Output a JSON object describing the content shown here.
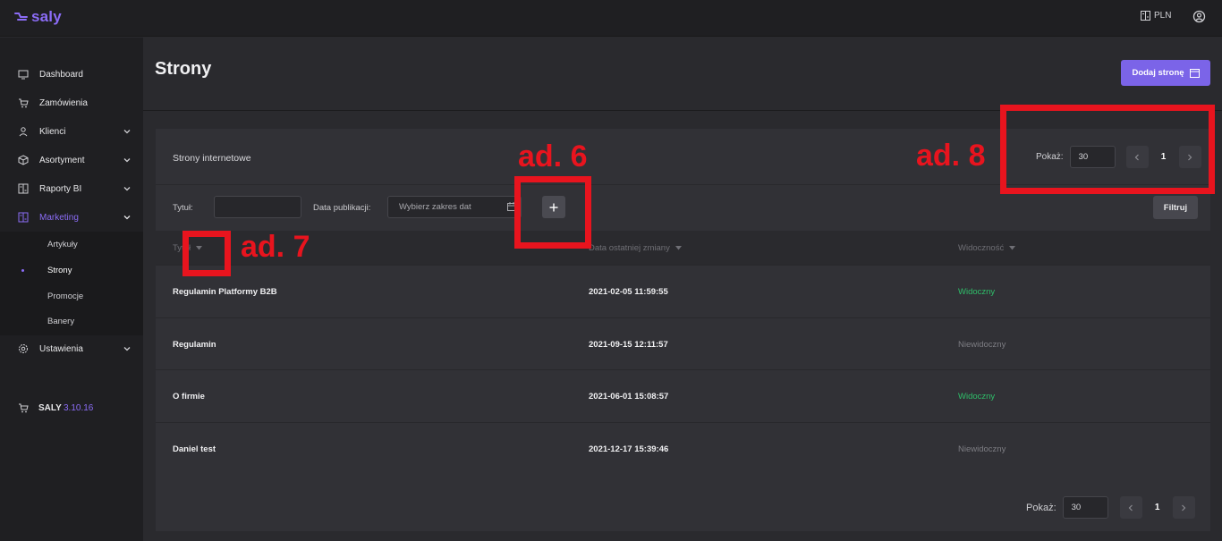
{
  "app": {
    "logo_text": "saly"
  },
  "topbar": {
    "currency_label": "PLN",
    "currency_icon": "currency-icon",
    "user_icon": "user-circle-icon"
  },
  "sidebar": {
    "items": [
      {
        "label": "Dashboard",
        "icon": "monitor-icon"
      },
      {
        "label": "Zamówienia",
        "icon": "cart-icon"
      },
      {
        "label": "Klienci",
        "icon": "person-icon"
      },
      {
        "label": "Asortyment",
        "icon": "box-icon"
      },
      {
        "label": "Raporty BI",
        "icon": "report-icon"
      },
      {
        "label": "Marketing",
        "icon": "marketing-icon"
      },
      {
        "label": "Ustawienia",
        "icon": "gear-icon"
      }
    ],
    "submenu": [
      {
        "label": "Artykuły"
      },
      {
        "label": "Strony"
      },
      {
        "label": "Promocje"
      },
      {
        "label": "Banery"
      }
    ],
    "version_label": "SALY",
    "version_number": "3.10.16"
  },
  "page": {
    "title": "Strony",
    "add_button_label": "Dodaj stronę"
  },
  "card": {
    "title": "Strony internetowe",
    "show_label": "Pokaż:",
    "per_page": "30",
    "current_page": "1",
    "filters": {
      "title_label": "Tytuł:",
      "title_value": "",
      "date_label": "Data publikacji:",
      "date_placeholder": "Wybierz zakres dat",
      "filter_button": "Filtruj"
    },
    "columns": [
      "Tytuł",
      "Data ostatniej zmiany",
      "Widoczność"
    ],
    "rows": [
      {
        "title": "Regulamin Platformy B2B",
        "date": "2021-02-05 11:59:55",
        "visibility": "Widoczny"
      },
      {
        "title": "Regulamin",
        "date": "2021-09-15 12:11:57",
        "visibility": "Niewidoczny"
      },
      {
        "title": "O firmie",
        "date": "2021-06-01 15:08:57",
        "visibility": "Widoczny"
      },
      {
        "title": "Daniel test",
        "date": "2021-12-17 15:39:46",
        "visibility": "Niewidoczny"
      }
    ]
  },
  "annotations": {
    "ad6": "ad. 6",
    "ad7": "ad. 7",
    "ad8": "ad. 8"
  },
  "colors": {
    "accent": "#8b6cf6",
    "visible": "#2fbf6a",
    "invisible": "#7d7d83",
    "annotation": "#e8141e"
  }
}
